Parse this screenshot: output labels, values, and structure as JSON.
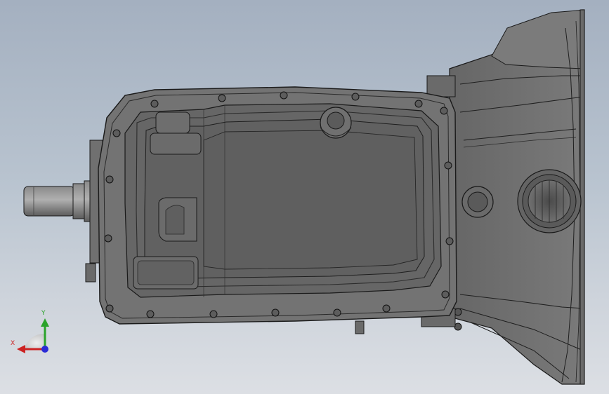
{
  "viewport": {
    "background_top": "#a4b0c0",
    "background_bottom": "#dcdfe4"
  },
  "model": {
    "part": "transmission-housing-with-oil-pan",
    "body_color": "#6c6c6c",
    "shade_color": "#555555",
    "edge_color": "#1a1a1a"
  },
  "triad": {
    "y_label": "Y",
    "x_label": "X",
    "y_color": "#2aa32a",
    "x_color": "#cc2222",
    "z_color": "#2b2bd6"
  }
}
